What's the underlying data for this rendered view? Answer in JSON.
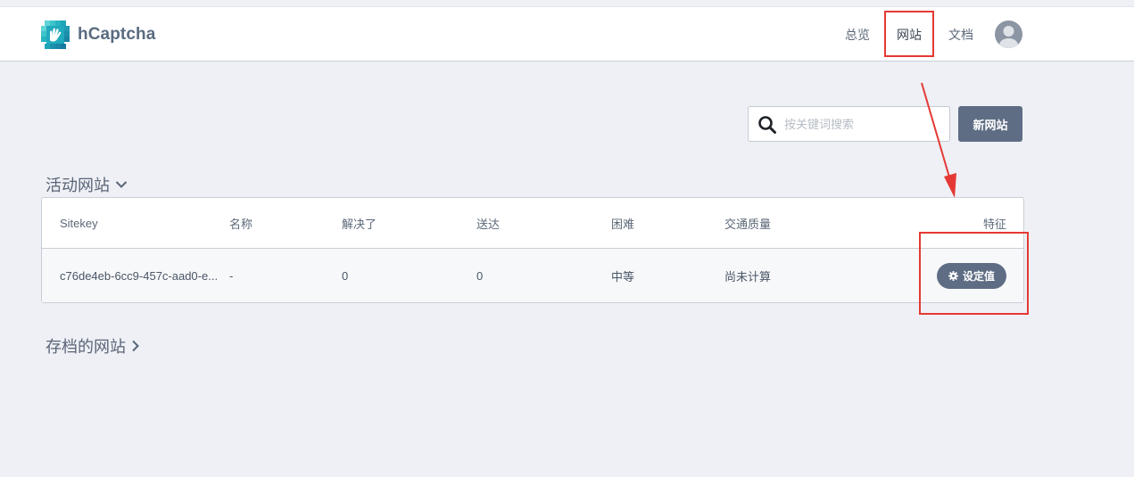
{
  "app": {
    "name": "hCaptcha"
  },
  "nav": {
    "overview": "总览",
    "sites": "网站",
    "docs": "文档"
  },
  "search": {
    "placeholder": "按关键词搜索"
  },
  "actions": {
    "new_site": "新网站"
  },
  "sections": {
    "active": "活动网站",
    "archived": "存档的网站"
  },
  "table": {
    "columns": [
      "Sitekey",
      "名称",
      "解决了",
      "送达",
      "困难",
      "交通质量",
      "特征"
    ],
    "rows": [
      {
        "sitekey": "c76de4eb-6cc9-457c-aad0-e...",
        "name": "-",
        "solved": "0",
        "delivered": "0",
        "difficulty": "中等",
        "traffic_quality": "尚未计算",
        "settings_label": "设定值"
      }
    ]
  },
  "colors": {
    "accent": "#5e6d84",
    "annotation": "#e53935",
    "logo_teal": "#1fb6c1"
  },
  "icons": {
    "logo": "hcaptcha-hand-logo",
    "search": "search-icon",
    "chevron_down": "chevron-down-icon",
    "chevron_right": "chevron-right-icon",
    "gear": "gear-icon",
    "avatar": "user-avatar-icon"
  }
}
